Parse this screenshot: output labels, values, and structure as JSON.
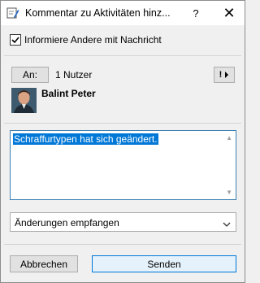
{
  "window": {
    "title": "Kommentar zu Aktivitäten hinz...",
    "help_label": "?",
    "close_label": "✕"
  },
  "notify": {
    "label": "Informiere Andere mit Nachricht",
    "checked": true
  },
  "recipients": {
    "to_button_label": "An:",
    "count_text": "1 Nutzer",
    "more_button_label": "!",
    "users": [
      {
        "name": "Balint Peter"
      }
    ]
  },
  "message": {
    "text": "Schraffurtypen hat sich geändert."
  },
  "event_select": {
    "selected": "Änderungen empfangen"
  },
  "footer": {
    "cancel_label": "Abbrechen",
    "send_label": "Senden"
  },
  "colors": {
    "accent": "#0078d7",
    "selection": "#0078d7"
  }
}
